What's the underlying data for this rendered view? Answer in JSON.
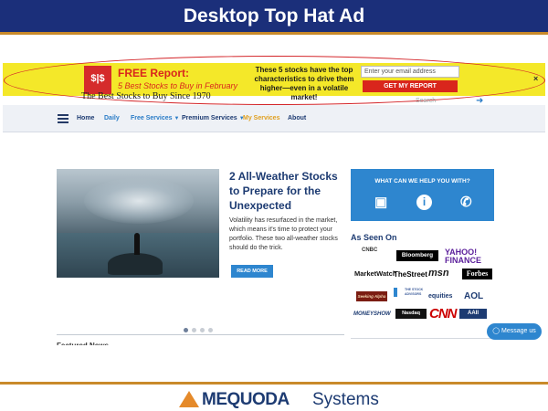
{
  "slide": {
    "title": "Desktop Top Hat Ad"
  },
  "ad": {
    "logo_glyph": "$|$",
    "heading": "FREE Report:",
    "subheading": "5 Best Stocks to Buy in February",
    "message": "These 5 stocks have the top characteristics to drive them higher—even in a volatile market!",
    "email_placeholder": "Enter your email address",
    "button_label": "GET MY REPORT",
    "close_label": "×",
    "colors": {
      "background": "#f4e829",
      "accent": "#d9261c",
      "highlight_ellipse": "#d4262a"
    }
  },
  "site": {
    "tagline": "The Best Stocks to Buy Since 1970",
    "search_placeholder": "Search",
    "search_icon": "arrow-right-icon"
  },
  "nav": {
    "items": [
      {
        "label": "Home",
        "color": "#1d3b72",
        "caret": false
      },
      {
        "label": "Daily",
        "color": "#2a7cc7",
        "caret": false
      },
      {
        "label": "Free Services",
        "color": "#2a7cc7",
        "caret": true
      },
      {
        "label": "Premium Services",
        "color": "#1d3b72",
        "caret": true
      },
      {
        "label": "My Services",
        "color": "#e0a020",
        "caret": false
      },
      {
        "label": "About",
        "color": "#1d3b72",
        "caret": false
      }
    ]
  },
  "article": {
    "title": "2 All-Weather Stocks to Prepare for the Unexpected",
    "body": "Volatility has resurfaced in the market, which means it's time to protect your portfolio. These two all-weather stocks should do the trick.",
    "read_more": "READ MORE",
    "carousel_dots": 4,
    "active_dot": 1,
    "next_heading": "Featured News"
  },
  "sidebar": {
    "help_title": "WHAT CAN WE HELP YOU WITH?",
    "help_icons": [
      "chat-icon",
      "info-icon",
      "phone-icon"
    ],
    "seen_on_title": "As Seen On",
    "logos": [
      {
        "name": "NBC",
        "text": "CNBC"
      },
      {
        "name": "bloomberg",
        "text": "Bloomberg"
      },
      {
        "name": "yahoo",
        "text": "YAHOO! FINANCE"
      },
      {
        "name": "marketwatch",
        "text": "MarketWatch"
      },
      {
        "name": "thestreet",
        "text": "TheStreet"
      },
      {
        "name": "msn",
        "text": "msn"
      },
      {
        "name": "forbes",
        "text": "Forbes"
      },
      {
        "name": "seekingalpha",
        "text": "Seeking Alpha"
      },
      {
        "name": "stockadvisors",
        "text": "THE STOCK ADVISORS"
      },
      {
        "name": "equities",
        "text": "equities"
      },
      {
        "name": "aol",
        "text": "AOL"
      },
      {
        "name": "moneyshow",
        "text": "MONEYSHOW"
      },
      {
        "name": "nasdaq",
        "text": "Nasdaq"
      },
      {
        "name": "cnn",
        "text": "CNN"
      },
      {
        "name": "aaii",
        "text": "AAII"
      }
    ],
    "message_button": "Message us"
  },
  "footer": {
    "brand": "MEQUODA",
    "divider": "|",
    "product": "Systems"
  }
}
